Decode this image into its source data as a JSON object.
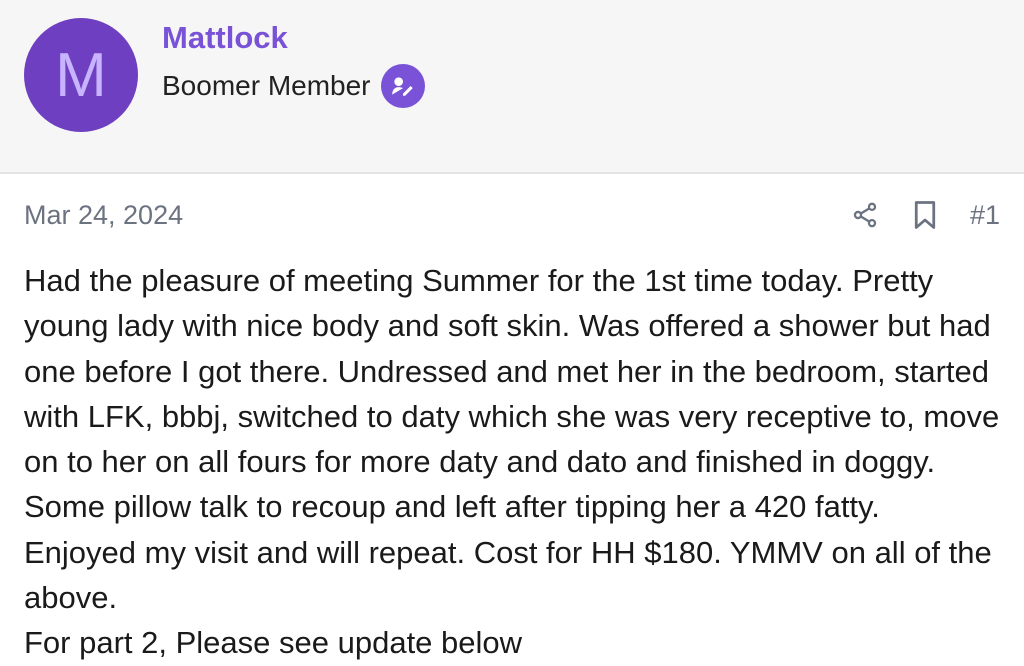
{
  "author": {
    "avatar_letter": "M",
    "username": "Mattlock",
    "title": "Boomer Member",
    "badge_icon": "edit-pen-icon"
  },
  "post": {
    "date": "Mar 24, 2024",
    "number": "#1",
    "share_icon": "share-icon",
    "bookmark_icon": "bookmark-icon",
    "body_paragraphs": [
      "Had the pleasure of meeting Summer for the 1st time today. Pretty young lady with nice body and soft skin. Was offered a shower but had one before I got there. Undressed and met her in the bedroom, started with LFK, bbbj, switched to daty which she was very receptive to, move on to her on all fours for more daty and dato and finished in doggy. Some pillow talk to recoup and left after tipping her a 420 fatty. Enjoyed my visit and will repeat. Cost for HH $180. YMMV on all of the above.",
      "For part 2, Please see update below"
    ]
  },
  "colors": {
    "accent": "#7a52d8",
    "avatar_bg": "#6f3fc1",
    "muted_text": "#6b7280"
  }
}
